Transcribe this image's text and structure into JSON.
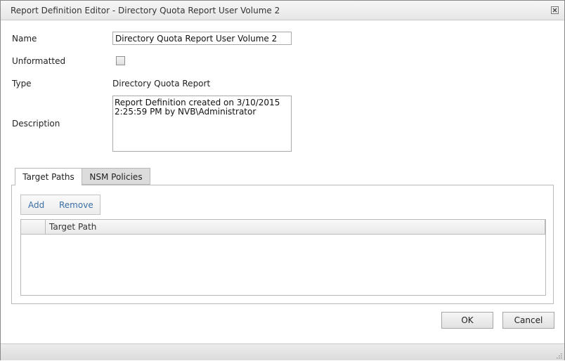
{
  "window": {
    "title": "Report Definition Editor - Directory Quota Report User Volume 2",
    "close_icon": "close-icon"
  },
  "form": {
    "name_label": "Name",
    "name_value": "Directory Quota Report User Volume 2",
    "unformatted_label": "Unformatted",
    "unformatted_checked": false,
    "type_label": "Type",
    "type_value": "Directory Quota Report",
    "description_label": "Description",
    "description_value": "Report Definition created on 3/10/2015 2:25:59 PM by NVB\\Administrator"
  },
  "tabs": [
    {
      "label": "Target Paths",
      "active": true
    },
    {
      "label": "NSM Policies",
      "active": false
    }
  ],
  "toolbar": {
    "add_label": "Add",
    "remove_label": "Remove"
  },
  "grid": {
    "columns": [
      "Target Path"
    ],
    "rows": []
  },
  "buttons": {
    "ok_label": "OK",
    "cancel_label": "Cancel"
  },
  "colors": {
    "link": "#3a6ea5",
    "inactive_tab": "#dcdcdc"
  }
}
